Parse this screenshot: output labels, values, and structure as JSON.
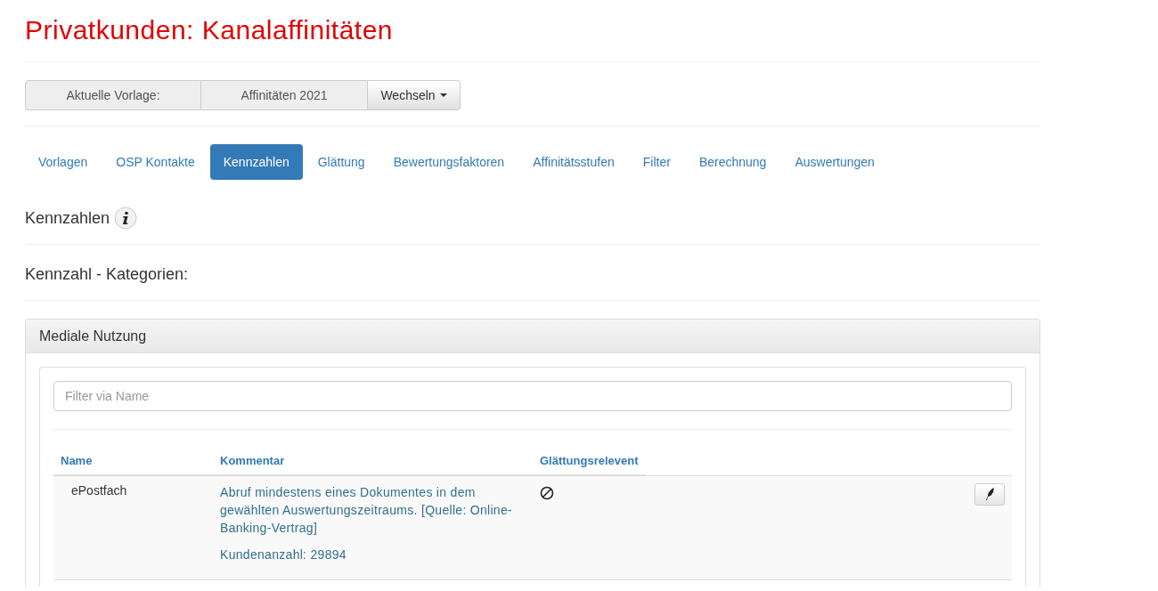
{
  "page_title": "Privatkunden: Kanalaffinitäten",
  "template_bar": {
    "label": "Aktuelle Vorlage:",
    "value": "Affinitäten 2021",
    "switch_button": "Wechseln"
  },
  "tabs": [
    {
      "label": "Vorlagen",
      "selected": false
    },
    {
      "label": "OSP Kontakte",
      "selected": false
    },
    {
      "label": "Kennzahlen",
      "selected": true
    },
    {
      "label": "Glättung",
      "selected": false
    },
    {
      "label": "Bewertungsfaktoren",
      "selected": false
    },
    {
      "label": "Affinitätsstufen",
      "selected": false
    },
    {
      "label": "Filter",
      "selected": false
    },
    {
      "label": "Berechnung",
      "selected": false
    },
    {
      "label": "Auswertungen",
      "selected": false
    }
  ],
  "section_heading": "Kennzahlen",
  "categories_heading": "Kennzahl - Kategorien:",
  "panel": {
    "title": "Mediale Nutzung",
    "filter": {
      "placeholder": "Filter via Name"
    },
    "table": {
      "columns": [
        "Name",
        "Kommentar",
        "Glättungsrelevent"
      ],
      "rows": [
        {
          "name": "ePostfach",
          "comment": "Abruf mindestens eines Dokumentes in dem gewählten Auswertungszeitraums. [Quelle: Online-Banking-Vertrag]",
          "count": "Kundenanzahl: 29894",
          "smoothing_relevant": false
        }
      ]
    }
  }
}
